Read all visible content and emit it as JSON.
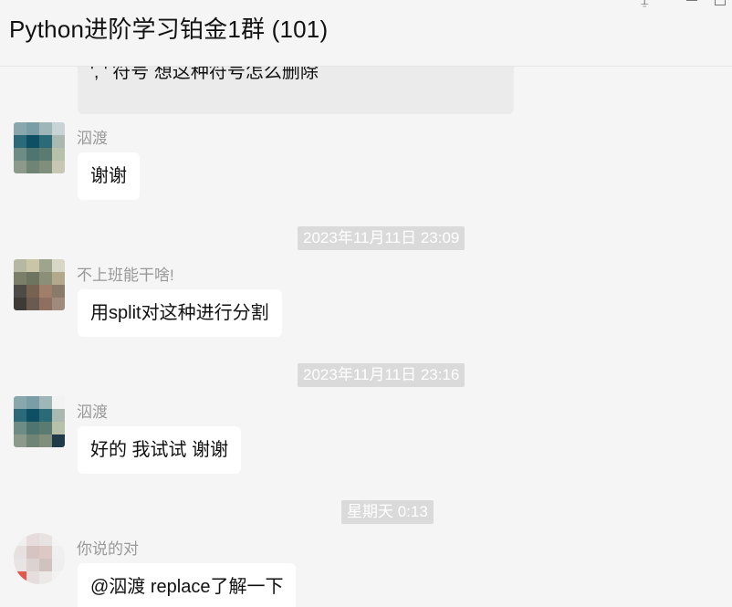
{
  "window": {
    "title": "Python进阶学习铂金1群 (101)"
  },
  "messages": [
    {
      "type": "partial",
      "text_line1": "', '    符号  想这种符号怎么删除"
    },
    {
      "type": "msg",
      "sender": "泅渡",
      "text": "谢谢"
    },
    {
      "type": "time",
      "text": "2023年11月11日 23:09"
    },
    {
      "type": "msg",
      "sender": "不上班能干啥!",
      "text": "用split对这种进行分割"
    },
    {
      "type": "time",
      "text": "2023年11月11日 23:16"
    },
    {
      "type": "msg",
      "sender": "泅渡",
      "text": "好的  我试试  谢谢"
    },
    {
      "type": "time",
      "text": "星期天 0:13"
    },
    {
      "type": "msg",
      "sender": "你说的对",
      "text": "@泅渡 replace了解一下"
    }
  ],
  "icons": {
    "pin": "pin-icon",
    "minimize": "minimize-icon",
    "maximize": "maximize-icon"
  }
}
